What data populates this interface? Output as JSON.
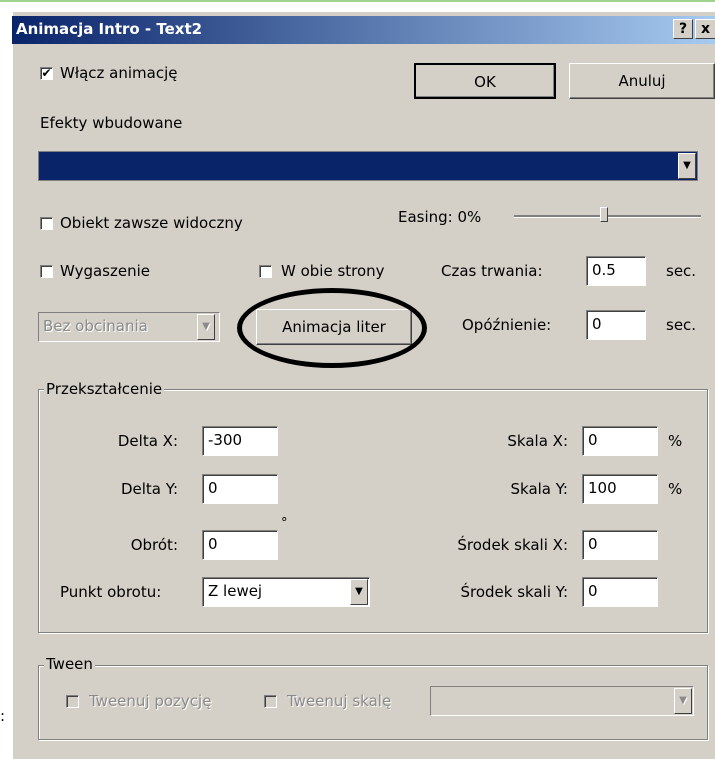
{
  "window": {
    "title": "Animacja Intro - Text2",
    "help_label": "?",
    "close_label": "x"
  },
  "enable_animation": {
    "label": "Włącz animację",
    "checked": true
  },
  "buttons": {
    "ok": "OK",
    "cancel": "Anuluj",
    "letter_animation": "Animacja liter"
  },
  "builtin_effects": {
    "label": "Efekty wbudowane",
    "selected": ""
  },
  "always_visible": {
    "label": "Obiekt zawsze widoczny",
    "checked": false
  },
  "easing": {
    "label": "Easing: 0%",
    "value": 0
  },
  "fade": {
    "label": "Wygaszenie",
    "checked": false
  },
  "both_ways": {
    "label": "W obie strony",
    "checked": false
  },
  "duration": {
    "label": "Czas trwania:",
    "value": "0.5",
    "unit": "sec."
  },
  "clipping": {
    "selected": "Bez obcinania"
  },
  "delay": {
    "label": "Opóźnienie:",
    "value": "0",
    "unit": "sec."
  },
  "transform": {
    "legend": "Przekształcenie",
    "delta_x": {
      "label": "Delta X:",
      "value": "-300"
    },
    "delta_y": {
      "label": "Delta Y:",
      "value": "0"
    },
    "rotation": {
      "label": "Obrót:",
      "value": "0",
      "unit": "°"
    },
    "pivot": {
      "label": "Punkt obrotu:",
      "selected": "Z lewej"
    },
    "scale_x": {
      "label": "Skala X:",
      "value": "0",
      "unit": "%"
    },
    "scale_y": {
      "label": "Skala Y:",
      "value": "100",
      "unit": "%"
    },
    "scale_center_x": {
      "label": "Środek skali X:",
      "value": "0"
    },
    "scale_center_y": {
      "label": "Środek skali Y:",
      "value": "0"
    }
  },
  "tween": {
    "legend": "Tween",
    "position": {
      "label": "Tweenuj pozycję",
      "checked": false
    },
    "scale": {
      "label": "Tweenuj skalę",
      "checked": false
    },
    "dropdown": {
      "selected": ""
    }
  },
  "colors": {
    "title_start": "#0a246a",
    "title_end": "#a6caf0",
    "dialog_bg": "#d4d0c8",
    "selection": "#0a246a"
  }
}
